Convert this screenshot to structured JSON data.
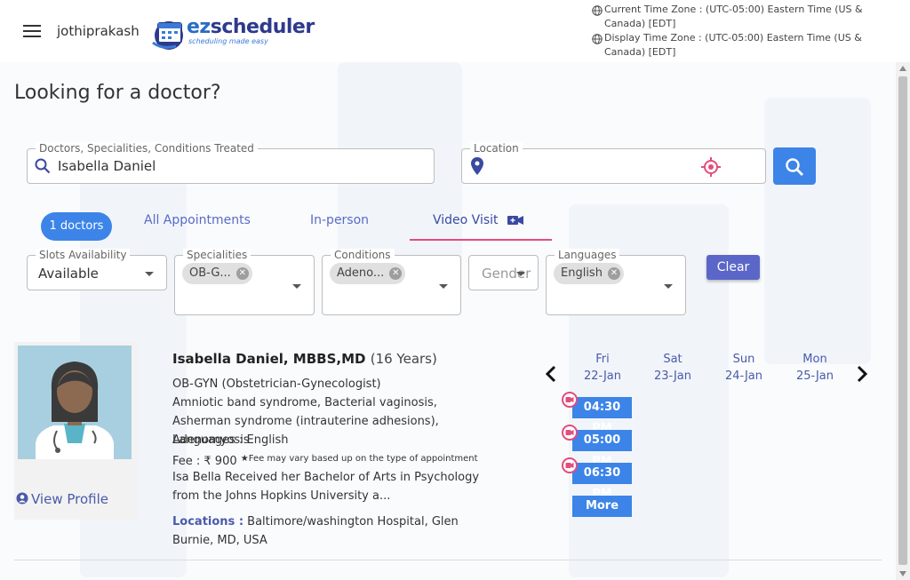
{
  "header": {
    "username": "jothiprakash",
    "logo": {
      "text_ez": "ez",
      "text_rest": "scheduler",
      "tagline": "scheduling made easy"
    },
    "current_tz": "Current Time Zone : (UTC-05:00) Eastern Time (US & Canada) [EDT]",
    "display_tz": "Display Time Zone : (UTC-05:00) Eastern Time (US & Canada) [EDT]"
  },
  "page_title": "Looking for a doctor?",
  "search": {
    "label": "Doctors, Specialities, Conditions Treated",
    "value": "Isabella Daniel"
  },
  "location": {
    "label": "Location",
    "value": ""
  },
  "tabs": {
    "count_pill": "1 doctors",
    "all": "All Appointments",
    "inperson": "In-person",
    "video": "Video Visit"
  },
  "filters": {
    "slots": {
      "label": "Slots Availability",
      "value": "Available"
    },
    "specialities": {
      "label": "Specialities",
      "chip": "OB-G..."
    },
    "conditions": {
      "label": "Conditions",
      "chip": "Adeno..."
    },
    "gender": {
      "placeholder": "Gender"
    },
    "languages": {
      "label": "Languages",
      "chip": "English"
    },
    "clear": "Clear"
  },
  "doctor": {
    "name": "Isabella Daniel, MBBS,MD",
    "experience": "(16 Years)",
    "speciality": "OB-GYN (Obstetrician-Gynecologist)",
    "conditions": "Amniotic band syndrome, Bacterial vaginosis, Asherman syndrome (intrauterine adhesions), Adenomyosis",
    "languages": "Languages : English",
    "fee": "Fee : ₹ 900",
    "fee_note": "Fee may vary based up on the type of appointment",
    "bio": "Isa Bella Received her Bachelor of Arts in Psychology from the Johns Hopkins University a...",
    "locations_label": "Locations :",
    "locations": "Baltimore/washington Hospital, Glen Burnie, MD, USA",
    "view_profile": "View Profile"
  },
  "calendar": {
    "days": [
      {
        "day": "Fri",
        "date": "22-Jan"
      },
      {
        "day": "Sat",
        "date": "23-Jan"
      },
      {
        "day": "Sun",
        "date": "24-Jan"
      },
      {
        "day": "Mon",
        "date": "25-Jan"
      }
    ],
    "slots": [
      "04:30 PM",
      "05:00 PM",
      "06:30 PM"
    ],
    "more": "More"
  },
  "colors": {
    "primary": "#3c84e8",
    "accent_underline": "#e34c7b",
    "link": "#4a5aa8",
    "clear_button": "#5a67c8"
  }
}
